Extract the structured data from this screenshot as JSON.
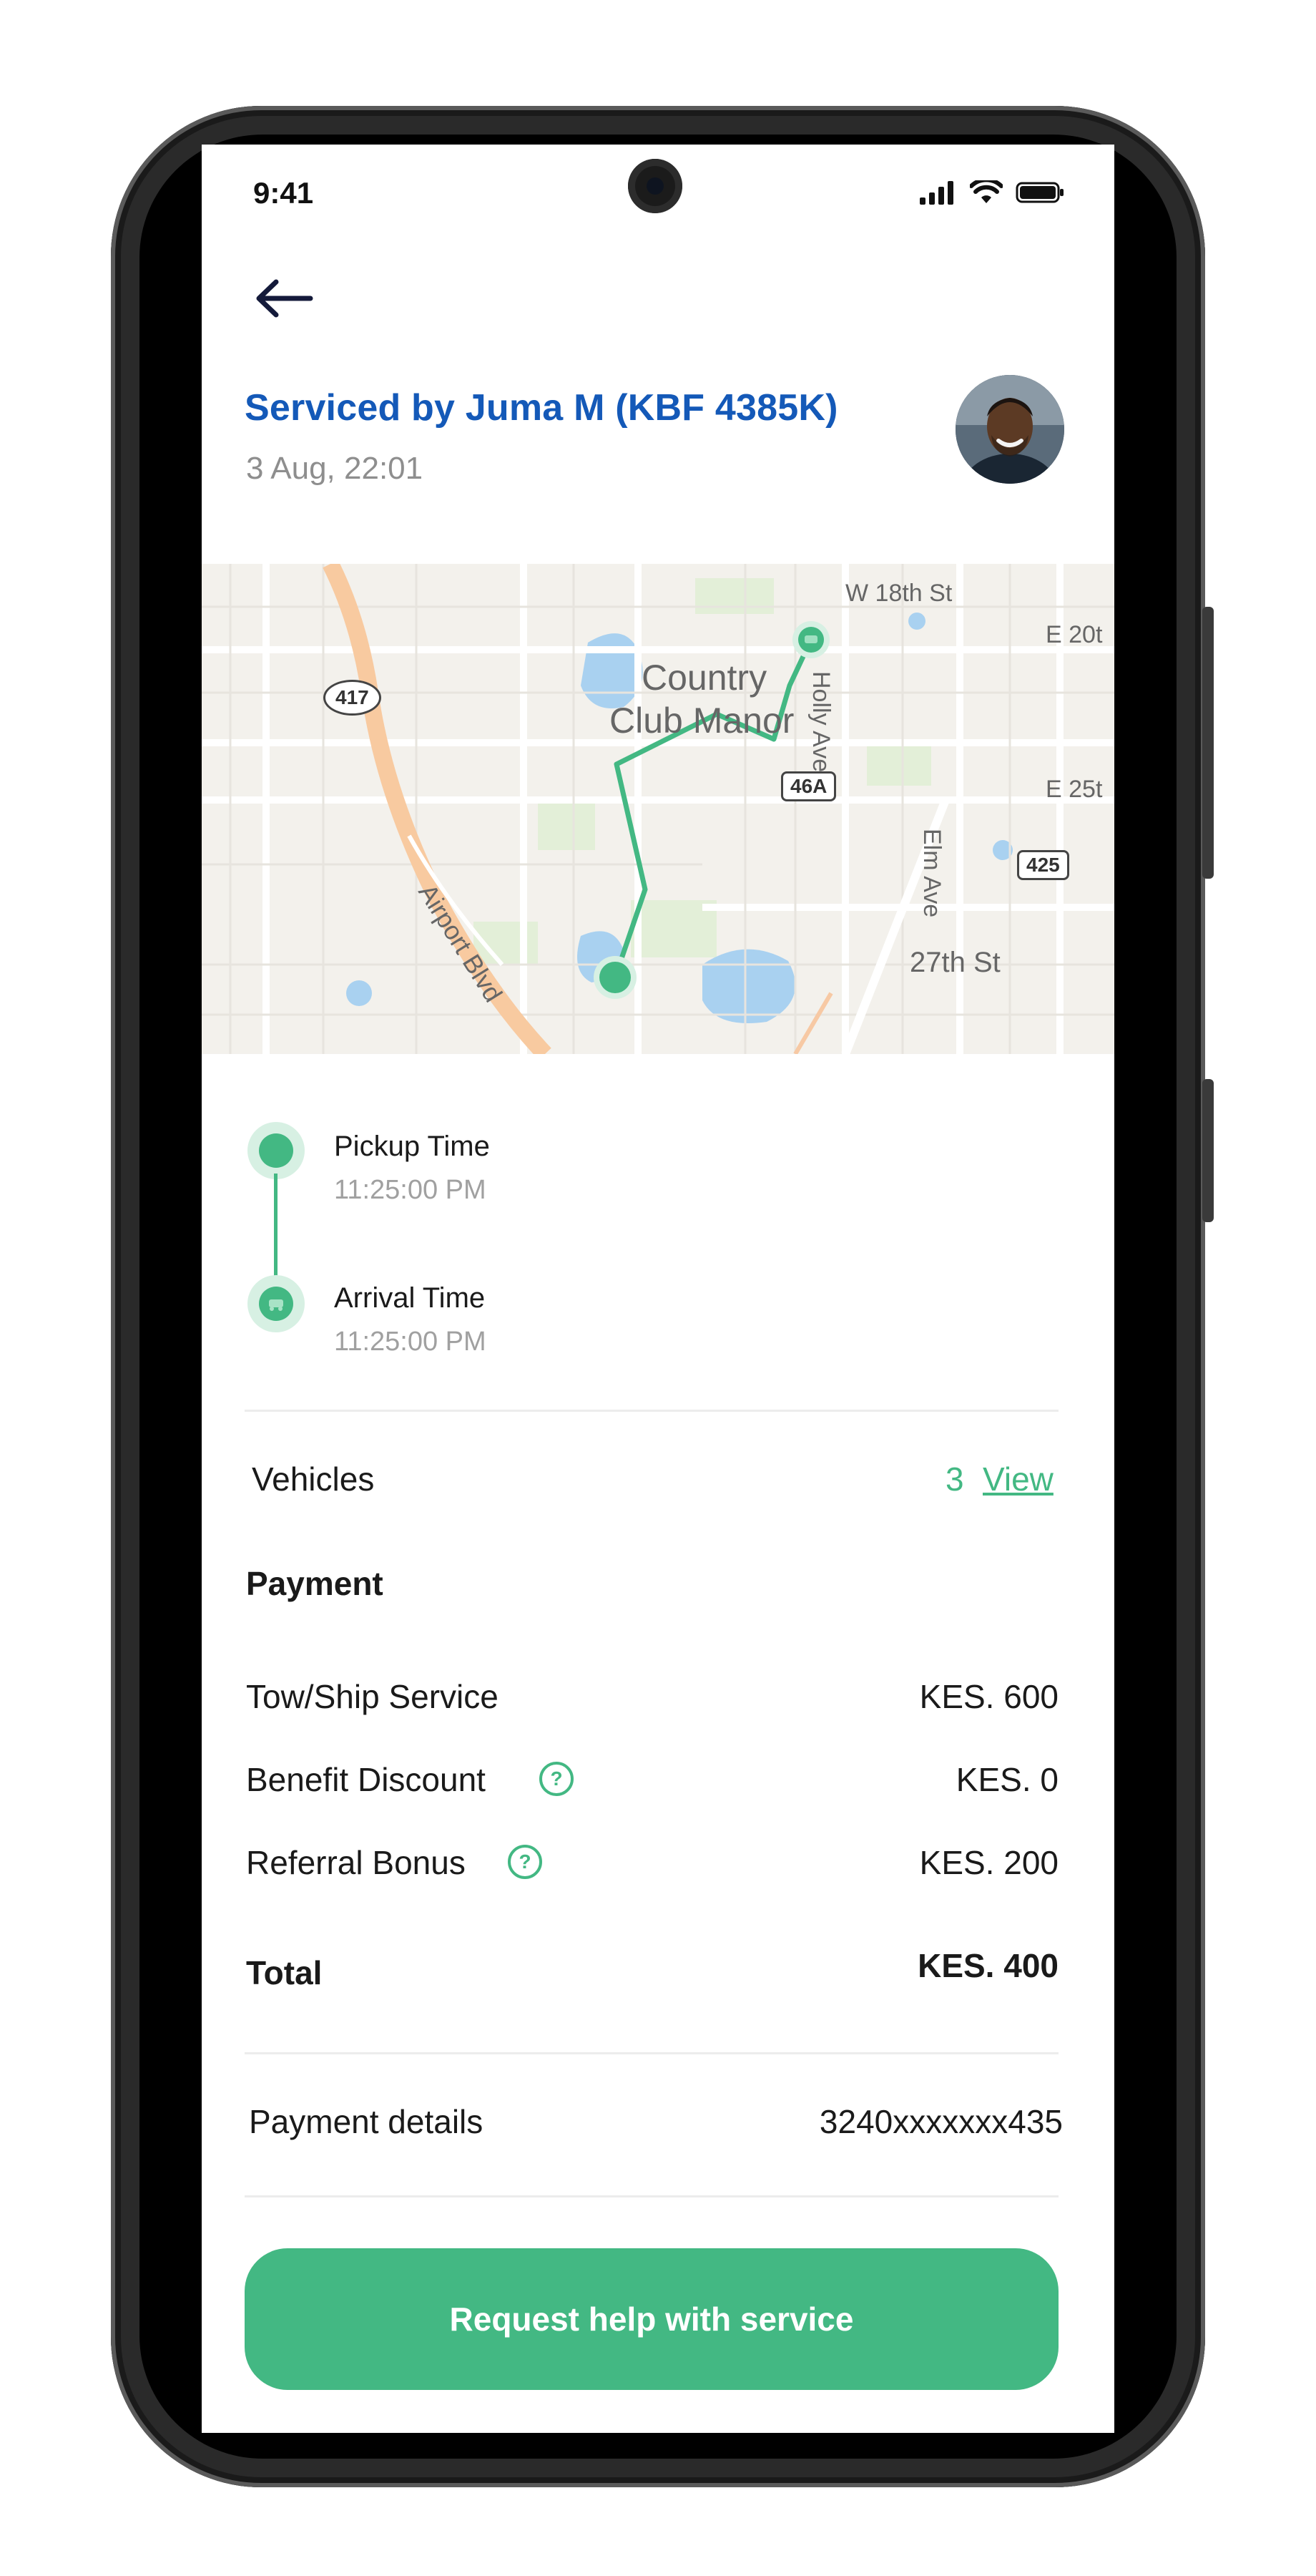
{
  "status_bar": {
    "time": "9:41"
  },
  "header": {
    "title": "Serviced by Juma M (KBF 4385K)",
    "datetime": "3 Aug, 22:01"
  },
  "map": {
    "labels": {
      "w18": "W 18th St",
      "country_club": "Country",
      "club_manor": "Club Manor",
      "holly": "Holly Ave",
      "e20": "E 20t",
      "e25": "E 25t",
      "elm": "Elm Ave",
      "st27": "27th St",
      "airport": "Airport Blvd"
    },
    "shields": {
      "s417": "417",
      "s46a": "46A",
      "s425": "425"
    }
  },
  "timeline": {
    "pickup_label": "Pickup Time",
    "pickup_time": "11:25:00 PM",
    "arrival_label": "Arrival Time",
    "arrival_time": "11:25:00 PM"
  },
  "vehicles": {
    "label": "Vehicles",
    "count": "3",
    "view_link": "View"
  },
  "payment": {
    "heading": "Payment",
    "items": [
      {
        "label": "Tow/Ship Service",
        "value": "KES. 600"
      },
      {
        "label": "Benefit Discount",
        "value": "KES. 0"
      },
      {
        "label": "Referral Bonus",
        "value": "KES. 200"
      }
    ],
    "help_glyph": "?",
    "total_label": "Total",
    "total_value": "KES. 400"
  },
  "payment_details": {
    "label": "Payment details",
    "value": "3240xxxxxxx435"
  },
  "cta": {
    "label": "Request help with service"
  },
  "colors": {
    "accent": "#43b883",
    "title_blue": "#1459b8",
    "muted": "#8e8e8e"
  }
}
